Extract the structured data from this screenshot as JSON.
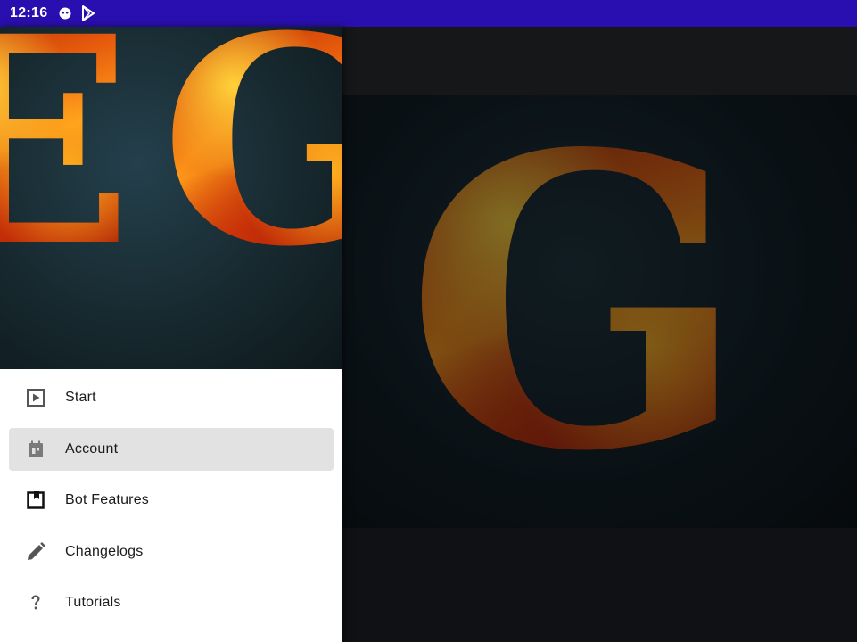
{
  "status_bar": {
    "time": "12:16",
    "icons": [
      "android-debug-icon",
      "play-store-icon"
    ]
  },
  "branding": {
    "header_letters": "EG",
    "hero_letters": "EG"
  },
  "drawer": {
    "items": [
      {
        "label": "Start",
        "icon": "play-box-icon",
        "selected": false
      },
      {
        "label": "Account",
        "icon": "account-box-icon",
        "selected": true
      },
      {
        "label": "Bot Features",
        "icon": "features-icon",
        "selected": false
      },
      {
        "label": "Changelogs",
        "icon": "pencil-icon",
        "selected": false
      },
      {
        "label": "Tutorials",
        "icon": "question-icon",
        "selected": false
      }
    ]
  },
  "colors": {
    "status_bar": "#2a0fb0",
    "selected_item": "#e2e2e2",
    "icon_gray": "#555555"
  }
}
